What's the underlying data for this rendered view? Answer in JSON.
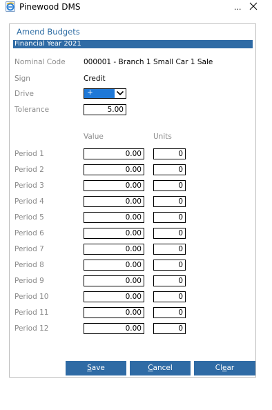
{
  "window": {
    "title": "Pinewood DMS",
    "more_label": "...",
    "close_label": "Close"
  },
  "panel": {
    "title": "Amend Budgets",
    "section": "Financial Year 2021"
  },
  "fields": {
    "nominal_code_label": "Nominal Code",
    "nominal_code_value": "000001 - Branch 1 Small Car 1 Sale",
    "sign_label": "Sign",
    "sign_value": "Credit",
    "drive_label": "Drive",
    "drive_value": "+",
    "tolerance_label": "Tolerance",
    "tolerance_value": "5.00"
  },
  "columns": {
    "value": "Value",
    "units": "Units"
  },
  "periods": [
    {
      "label": "Period 1",
      "value": "0.00",
      "units": "0"
    },
    {
      "label": "Period 2",
      "value": "0.00",
      "units": "0"
    },
    {
      "label": "Period 3",
      "value": "0.00",
      "units": "0"
    },
    {
      "label": "Period 4",
      "value": "0.00",
      "units": "0"
    },
    {
      "label": "Period 5",
      "value": "0.00",
      "units": "0"
    },
    {
      "label": "Period 6",
      "value": "0.00",
      "units": "0"
    },
    {
      "label": "Period 7",
      "value": "0.00",
      "units": "0"
    },
    {
      "label": "Period 8",
      "value": "0.00",
      "units": "0"
    },
    {
      "label": "Period 9",
      "value": "0.00",
      "units": "0"
    },
    {
      "label": "Period 10",
      "value": "0.00",
      "units": "0"
    },
    {
      "label": "Period 11",
      "value": "0.00",
      "units": "0"
    },
    {
      "label": "Period 12",
      "value": "0.00",
      "units": "0"
    }
  ],
  "buttons": {
    "save_first": "S",
    "save_rest": "ave",
    "cancel_first": "C",
    "cancel_rest": "ancel",
    "clear_first": "Cl",
    "clear_u": "e",
    "clear_rest": "ar"
  },
  "colors": {
    "accent": "#2f6ba5",
    "title_text": "#2e6da4",
    "label_text": "#8a8a8a",
    "selected_option": "#1e78d7"
  },
  "icons": {
    "app": "ie-globe-icon",
    "close": "close-icon",
    "dropdown": "chevron-down-icon"
  }
}
